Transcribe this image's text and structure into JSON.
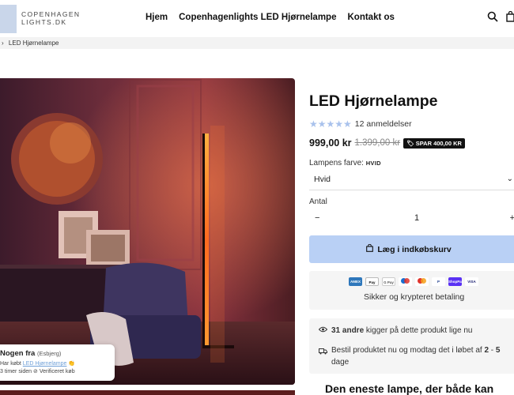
{
  "header": {
    "logo_line1": "COPENHAGEN",
    "logo_line2": "LIGHTS.DK",
    "nav": [
      "Hjem",
      "Copenhagenlights LED Hjørnelampe",
      "Kontakt os"
    ],
    "icons": [
      "search-icon",
      "cart-icon"
    ]
  },
  "breadcrumb": {
    "sep": "›",
    "current": "LED Hjørnelampe"
  },
  "popup": {
    "name": "Nogen fra",
    "city": "(Esbjerg)",
    "bought_prefix": "Har købt",
    "product_link": "LED Hjørnelampe",
    "time": "3 timer siden",
    "verified": "Verificeret køb"
  },
  "product": {
    "title": "LED Hjørnelampe",
    "rating_stars": 5,
    "reviews": "12 anmeldelser",
    "price": "999,00 kr",
    "old_price": "1.399,00 kr",
    "save_badge": "SPAR 400,00 KR",
    "color_label": "Lampens farve:",
    "color_value_label": "HVID",
    "color_selected": "Hvid",
    "qty_label": "Antal",
    "qty_minus": "−",
    "qty_value": "1",
    "qty_plus": "+",
    "cart_button": "Læg i indkøbskurv",
    "payment_methods": [
      "AMEX",
      "Pay",
      "G Pay",
      "maestro",
      "mc",
      "P",
      "ShopPay",
      "VISA"
    ],
    "secure_text": "Sikker og krypteret betaling",
    "viewers_bold": "31 andre",
    "viewers_rest": "kigger på dette produkt lige nu",
    "delivery_text_a": "Bestil produktet nu og modtag det i løbet af",
    "delivery_bold_a": "2",
    "delivery_dash": "-",
    "delivery_bold_b": "5",
    "delivery_text_b": "dage",
    "headline": "Den eneste lampe, der både kan"
  },
  "colors": {
    "accent": "#b9d0f5",
    "stars": "#a9c2ec",
    "badge": "#111111"
  }
}
